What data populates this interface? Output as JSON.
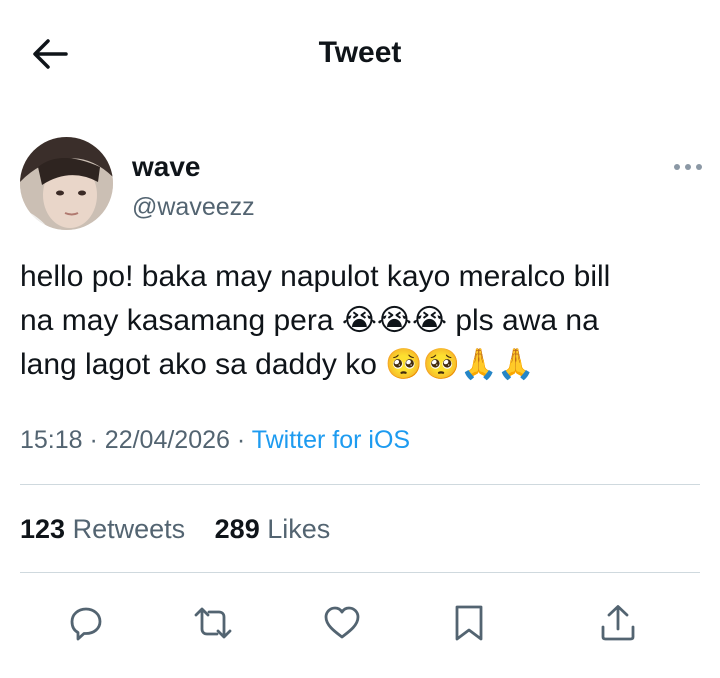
{
  "header": {
    "title": "Tweet",
    "back_icon": "arrow-left-icon"
  },
  "user": {
    "name": "wave",
    "handle": "@waveezz",
    "avatar": "profile-photo"
  },
  "tweet": {
    "text_line1": "hello po! baka may napulot kayo meralco bill",
    "text_line2": "na may kasamang pera 😭😭😭 pls awa na",
    "text_line3": "lang lagot ako sa daddy ko 🥺🥺🙏🙏",
    "time": "15:18",
    "date": "22/04/2026",
    "separator": "·",
    "source": "Twitter for iOS"
  },
  "stats": {
    "retweets_count": "123",
    "retweets_label": "Retweets",
    "likes_count": "289",
    "likes_label": "Likes"
  },
  "actions": [
    "reply-icon",
    "retweet-icon",
    "like-icon",
    "bookmark-icon",
    "share-icon"
  ],
  "colors": {
    "link": "#1d9bf0",
    "secondary": "#536471",
    "text": "#0f1419",
    "divider": "#cfd9de"
  }
}
